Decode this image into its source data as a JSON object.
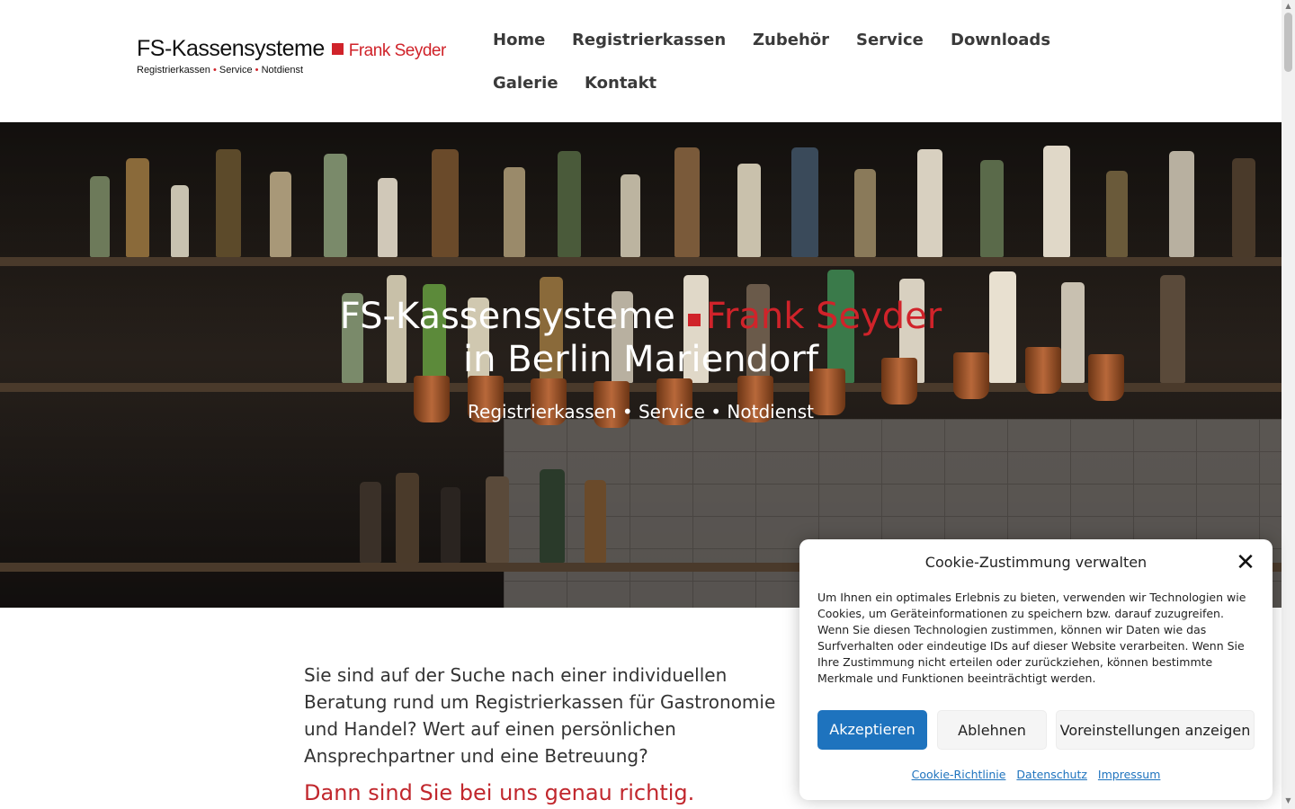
{
  "logo": {
    "name": "FS-Kassensysteme",
    "owner": "Frank Seyder",
    "tagline_items": [
      "Registrierkassen",
      "Service",
      "Notdienst"
    ],
    "tagline_sep": "•"
  },
  "nav": {
    "items": [
      "Home",
      "Registrierkassen",
      "Zubehör",
      "Service",
      "Downloads",
      "Galerie",
      "Kontakt"
    ]
  },
  "hero": {
    "title_left": "FS-Kassensysteme",
    "title_right": "Frank Seyder",
    "title_line2": "in Berlin Mariendorf",
    "subtitle": "Registrierkassen •  Service •  Notdienst"
  },
  "content": {
    "paragraph": "Sie sind auf der Suche nach einer individuellen Beratung rund um Registrierkassen für Gastronomie und Handel? Wert auf einen persönlichen Ansprechpartner und eine Betreuung?",
    "highlight": "Dann sind Sie bei uns genau richtig."
  },
  "cookie": {
    "title": "Cookie-Zustimmung verwalten",
    "close_icon": "close-icon",
    "body": "Um Ihnen ein optimales Erlebnis zu bieten, verwenden wir Technologien wie Cookies, um Geräteinformationen zu speichern bzw. darauf zuzugreifen. Wenn Sie diesen Technologien zustimmen, können wir Daten wie das Surfverhalten oder eindeutige IDs auf dieser Website verarbeiten. Wenn Sie Ihre Zustimmung nicht erteilen oder zurückziehen, können bestimmte Merkmale und Funktionen beeinträchtigt werden.",
    "accept_label": "Akzeptieren",
    "deny_label": "Ablehnen",
    "prefs_label": "Voreinstellungen anzeigen",
    "links": [
      "Cookie-Richtlinie",
      "Datenschutz",
      "Impressum"
    ]
  },
  "colors": {
    "brand_red": "#d0232a",
    "accent_blue": "#1e73be"
  }
}
